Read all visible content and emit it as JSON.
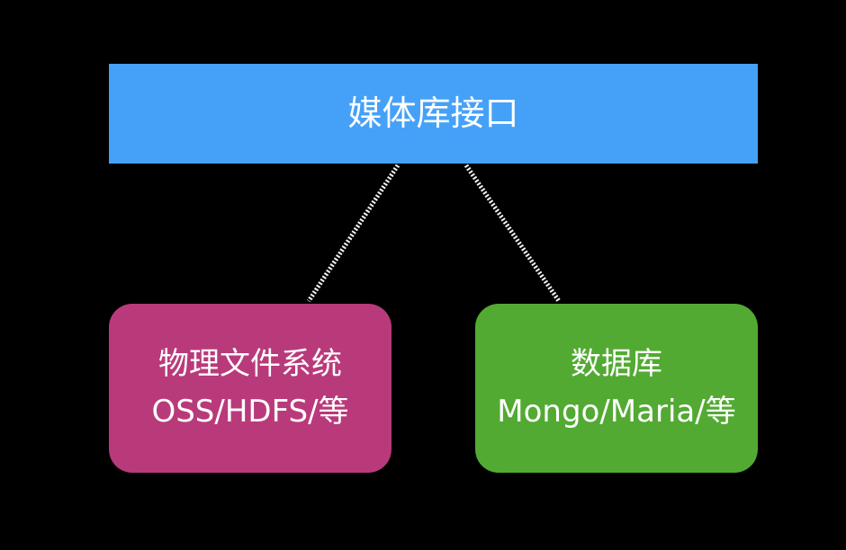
{
  "top": {
    "label": "媒体库接口",
    "color": "#45A1F8"
  },
  "left": {
    "line1": "物理文件系统",
    "line2": "OSS/HDFS/等",
    "color": "#B93A7A"
  },
  "right": {
    "line1": "数据库",
    "line2": "Mongo/Maria/等",
    "color": "#52AA33"
  },
  "connector_color": "#F2F2F2"
}
